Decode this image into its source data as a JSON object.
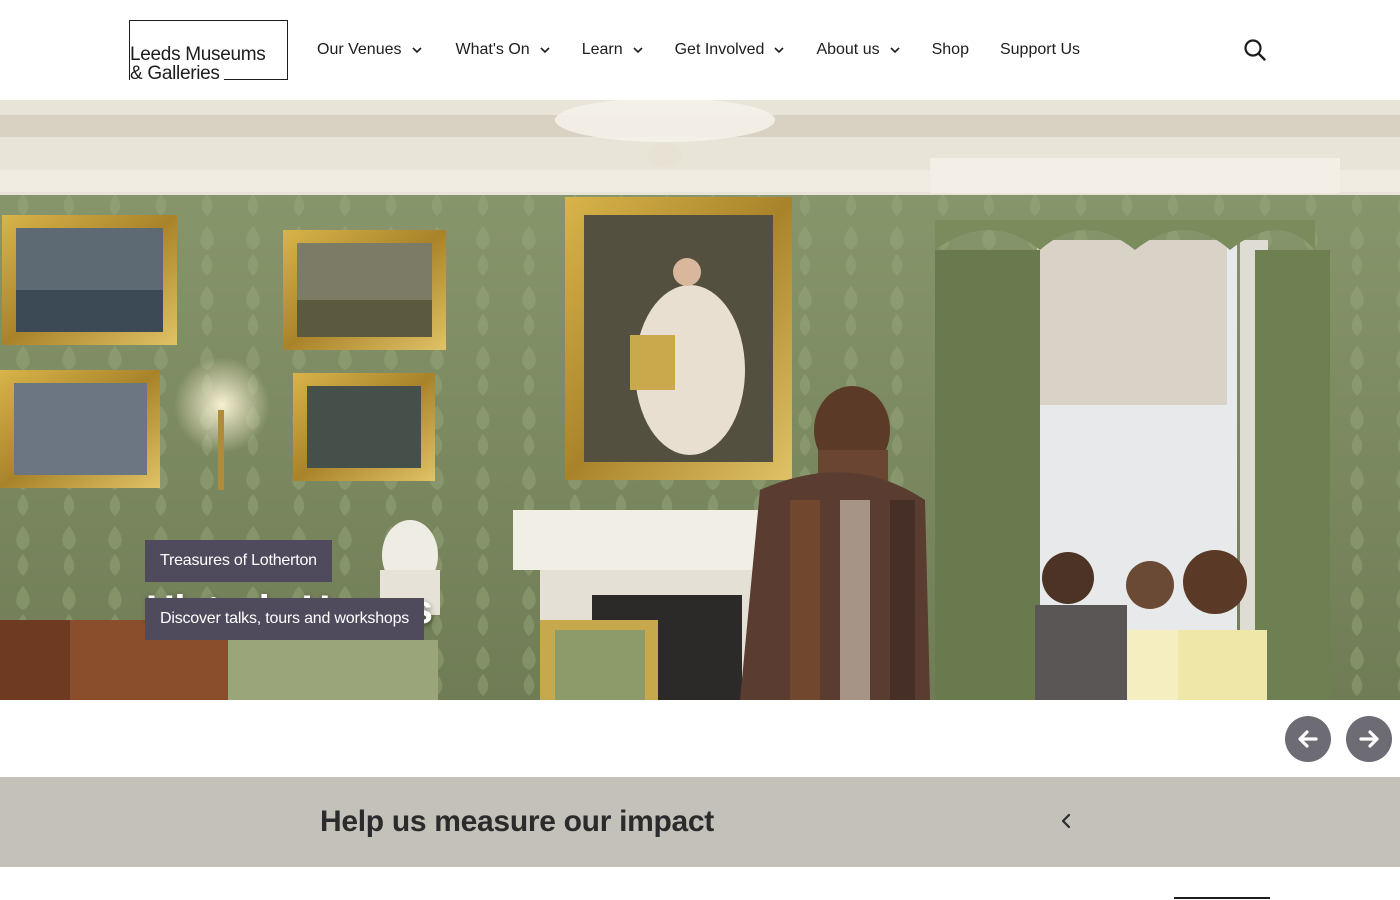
{
  "logo": {
    "line1": "Leeds Museums",
    "line2": "& Galleries"
  },
  "nav": {
    "items": [
      {
        "label": "Our Venues",
        "has_dropdown": true
      },
      {
        "label": "What's On",
        "has_dropdown": true
      },
      {
        "label": "Learn",
        "has_dropdown": true
      },
      {
        "label": "Get Involved",
        "has_dropdown": true
      },
      {
        "label": "About us",
        "has_dropdown": true
      },
      {
        "label": "Shop",
        "has_dropdown": false
      },
      {
        "label": "Support Us",
        "has_dropdown": false
      }
    ],
    "search_icon": "search-icon"
  },
  "hero": {
    "title": "Historic Homes",
    "buttons": [
      {
        "label": "Treasures of Lotherton"
      },
      {
        "label": "Discover talks, tours and workshops"
      }
    ]
  },
  "carousel": {
    "prev_icon": "arrow-left-icon",
    "next_icon": "arrow-right-icon"
  },
  "impact": {
    "title": "Help us measure our impact",
    "toggle_icon": "chevron-left-icon"
  },
  "colors": {
    "hero_button_bg": "#4f4b5c",
    "arrow_bg": "#6d6b73",
    "impact_bg": "#c4c1bb"
  }
}
